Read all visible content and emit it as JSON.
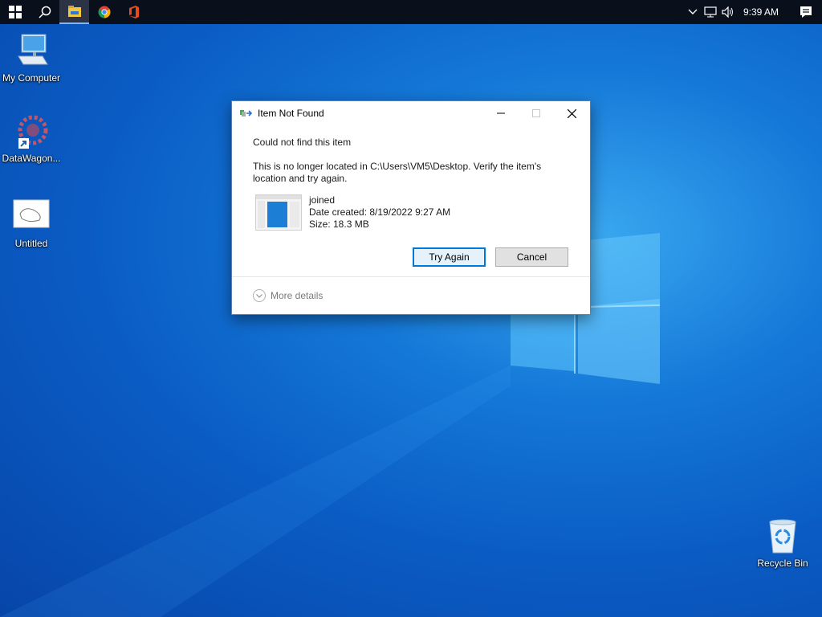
{
  "taskbar": {
    "start": "windows-start-icon",
    "search": "search-icon",
    "apps": [
      "file-explorer-icon",
      "chrome-icon",
      "office-icon"
    ],
    "clock": "9:39 AM"
  },
  "desktop": {
    "icons": [
      {
        "label": "My Computer",
        "icon": "computer-icon"
      },
      {
        "label": "DataWagon...",
        "icon": "datawagon-icon"
      },
      {
        "label": "Untitled",
        "icon": "image-file-icon"
      },
      {
        "label": "Recycle Bin",
        "icon": "recycle-bin-icon"
      }
    ]
  },
  "dialog": {
    "title": "Item Not Found",
    "heading": "Could not find this item",
    "message": "This is no longer located in C:\\Users\\VM5\\Desktop. Verify the item's location and try again.",
    "file": {
      "name": "joined",
      "date_created": "Date created: 8/19/2022 9:27 AM",
      "size": "Size: 18.3 MB"
    },
    "buttons": {
      "try_again": "Try Again",
      "cancel": "Cancel"
    },
    "more_details": "More details"
  },
  "colors": {
    "taskbar": "#0a0f1c",
    "accent": "#0078d7",
    "desktop": "#0a5cc4"
  }
}
